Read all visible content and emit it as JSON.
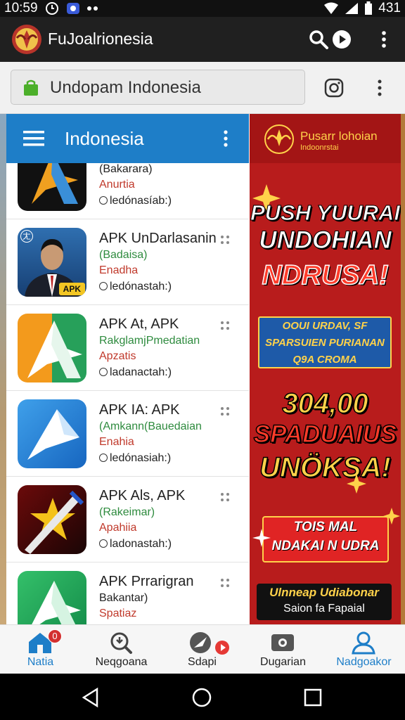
{
  "status_bar": {
    "time": "10:59",
    "battery": "431"
  },
  "app_bar": {
    "title": "FuJoalrionesia"
  },
  "url_bar": {
    "text": "Undopam Indonesia"
  },
  "panel": {
    "title": "Indonesia",
    "items": [
      {
        "name": "",
        "subtitle": "(Bakarara)",
        "tag": "Anurtia",
        "status": "ledónasíab:)",
        "icon": "apk-a-dark-icon"
      },
      {
        "name": "APK UnDarlasanin",
        "subtitle": "(Badaisa)",
        "tag": "Enadha",
        "status": "ledónastah:)",
        "icon": "person-portrait-icon",
        "badge": "APK",
        "corner": "ㄤ"
      },
      {
        "name": "APK At, APK",
        "subtitle": "RakglamjPmedatian",
        "tag": "Apzatis",
        "status": "ladanactah:)",
        "icon": "apk-a-orange-green-icon"
      },
      {
        "name": "APK IA: APK",
        "subtitle": "(Amkann(Bauedaian",
        "tag": "Enahia",
        "status": "ledónasiah:)",
        "icon": "apk-a-blue-icon"
      },
      {
        "name": "APK Als, APK",
        "subtitle": "(Rakeimar)",
        "tag": "Apahiia",
        "status": "ladonastah:)",
        "icon": "sword-star-icon"
      },
      {
        "name": "APK Prrarigran",
        "subtitle": "Bakantar)",
        "tag": "Spatiaz",
        "status": "",
        "icon": "apk-a-green-icon"
      }
    ]
  },
  "ad": {
    "header_title": "Pusarr lohoian",
    "header_sub": "Indoonrstai",
    "line1": "PUSH YUURAI",
    "line2": "UNDOHIAN",
    "line3": "NDRUSA!",
    "blue_line1": "OOUI URDAV, SF",
    "blue_line2": "SPARSUIEN PURIANAN",
    "blue_line3": "Q9A CROMA",
    "line4": "304,00",
    "line5": "SPADUAIUS",
    "line6": "UNÖKSA!",
    "button_line1": "TOIS MAL",
    "button_line2": "NDAKAI N UDRA",
    "footer_line1": "Ulnneap Udiabonar",
    "footer_line2": "Saion fa Fapaial"
  },
  "bottom_nav": [
    {
      "label": "Natia",
      "icon": "home-icon",
      "badge": "0"
    },
    {
      "label": "Neqgoana",
      "icon": "search-zoom-icon"
    },
    {
      "label": "Sdapi",
      "icon": "compass-icon"
    },
    {
      "label": "Dugarian",
      "icon": "media-icon"
    },
    {
      "label": "Nadgoakor",
      "icon": "account-icon"
    }
  ],
  "colors": {
    "accent": "#1e7ec8",
    "ad_red": "#b81c1c",
    "ad_gold": "#ffd24a"
  }
}
